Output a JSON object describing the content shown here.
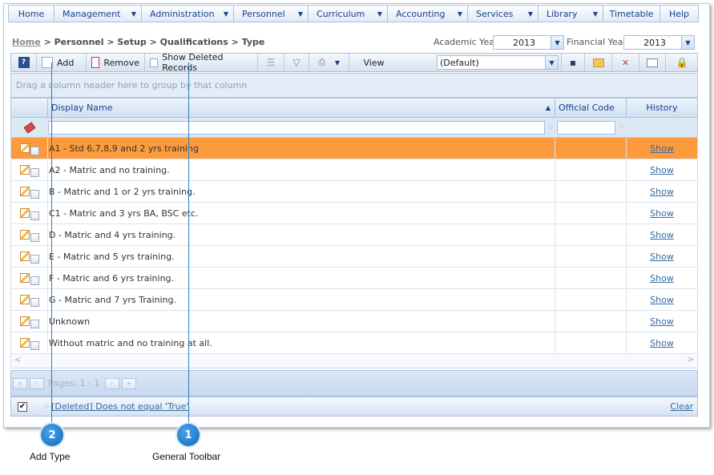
{
  "menu": [
    "Home",
    "Management",
    "Administration",
    "Personnel",
    "Curriculum",
    "Accounting",
    "Services",
    "Library",
    "Timetable",
    "Help"
  ],
  "menu_has_caret": [
    false,
    true,
    true,
    true,
    true,
    true,
    true,
    true,
    false,
    false
  ],
  "breadcrumb": {
    "home": "Home",
    "rest": " > Personnel > Setup > Qualifications > Type"
  },
  "academic_year": {
    "label": "Academic Year",
    "value": "2013"
  },
  "financial_year": {
    "label": "Financial Year",
    "value": "2013"
  },
  "toolbar": {
    "add": "Add",
    "remove": "Remove",
    "show_deleted": "Show Deleted Records",
    "view_label": "View",
    "view_value": "(Default)"
  },
  "group_hint": "Drag a column header here to group by that column",
  "columns": {
    "display_name": "Display Name",
    "official_code": "Official Code",
    "history": "History"
  },
  "rows": [
    {
      "name": "A1 - Std 6,7,8,9 and 2 yrs training",
      "code": "",
      "history": "Show",
      "selected": true
    },
    {
      "name": "A2 - Matric and no training.",
      "code": "",
      "history": "Show"
    },
    {
      "name": "B - Matric and 1 or 2 yrs training.",
      "code": "",
      "history": "Show"
    },
    {
      "name": "C1 - Matric and 3 yrs BA, BSC etc.",
      "code": "",
      "history": "Show"
    },
    {
      "name": "D - Matric and 4 yrs training.",
      "code": "",
      "history": "Show"
    },
    {
      "name": "E - Matric and 5 yrs training.",
      "code": "",
      "history": "Show"
    },
    {
      "name": "F - Matric and 6 yrs training.",
      "code": "",
      "history": "Show"
    },
    {
      "name": "G - Matric and 7 yrs Training.",
      "code": "",
      "history": "Show"
    },
    {
      "name": "Unknown",
      "code": "",
      "history": "Show"
    },
    {
      "name": "Without matric and no training at all.",
      "code": "",
      "history": "Show"
    }
  ],
  "pager": {
    "text": "Pages: 1 - 1"
  },
  "filter": {
    "text": "[Deleted] Does not equal 'True'",
    "clear": "Clear"
  },
  "callouts": [
    {
      "number": "2",
      "label": "Add Type"
    },
    {
      "number": "1",
      "label": "General Toolbar"
    }
  ],
  "colors": {
    "accent": "#15428b",
    "selected_row": "#fd9a3c",
    "badge": "#1069b8"
  }
}
